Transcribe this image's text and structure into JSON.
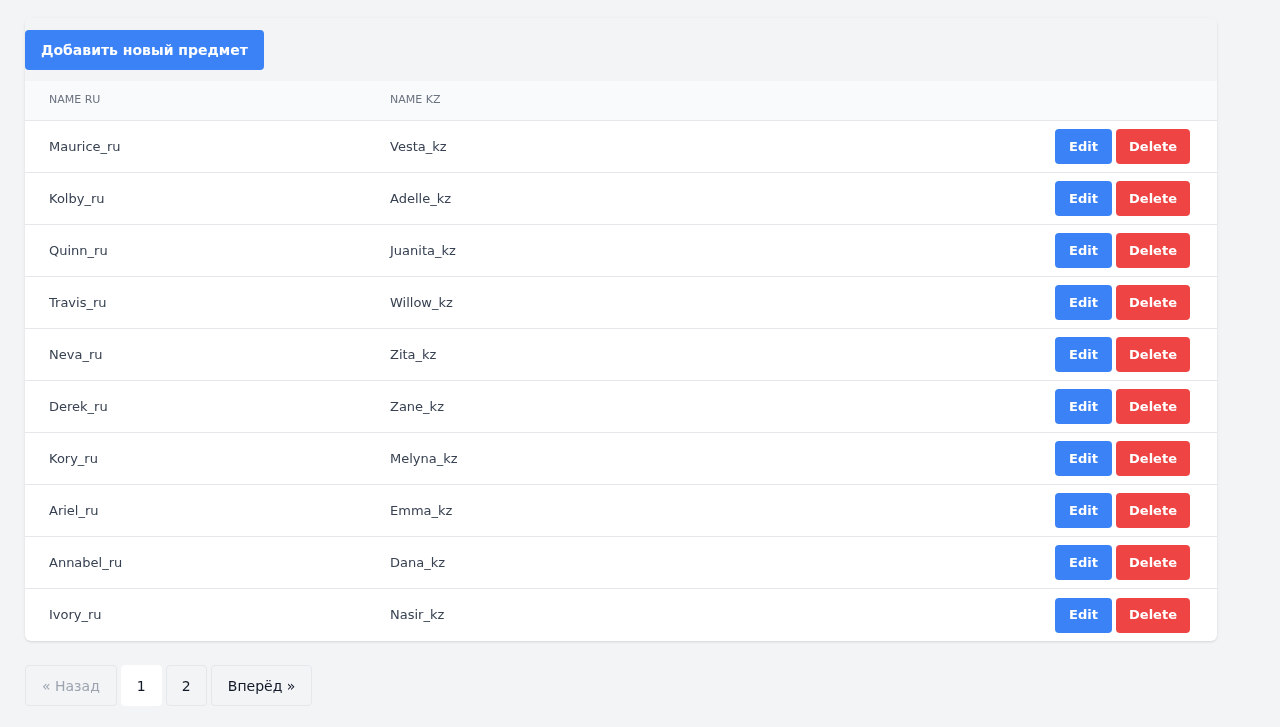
{
  "add_button": "Добавить новый предмет",
  "table": {
    "columns": [
      "NAME RU",
      "NAME KZ"
    ],
    "rows": [
      {
        "name_ru": "Maurice_ru",
        "name_kz": "Vesta_kz",
        "edit": "Edit",
        "delete": "Delete"
      },
      {
        "name_ru": "Kolby_ru",
        "name_kz": "Adelle_kz",
        "edit": "Edit",
        "delete": "Delete"
      },
      {
        "name_ru": "Quinn_ru",
        "name_kz": "Juanita_kz",
        "edit": "Edit",
        "delete": "Delete"
      },
      {
        "name_ru": "Travis_ru",
        "name_kz": "Willow_kz",
        "edit": "Edit",
        "delete": "Delete"
      },
      {
        "name_ru": "Neva_ru",
        "name_kz": "Zita_kz",
        "edit": "Edit",
        "delete": "Delete"
      },
      {
        "name_ru": "Derek_ru",
        "name_kz": "Zane_kz",
        "edit": "Edit",
        "delete": "Delete"
      },
      {
        "name_ru": "Kory_ru",
        "name_kz": "Melyna_kz",
        "edit": "Edit",
        "delete": "Delete"
      },
      {
        "name_ru": "Ariel_ru",
        "name_kz": "Emma_kz",
        "edit": "Edit",
        "delete": "Delete"
      },
      {
        "name_ru": "Annabel_ru",
        "name_kz": "Dana_kz",
        "edit": "Edit",
        "delete": "Delete"
      },
      {
        "name_ru": "Ivory_ru",
        "name_kz": "Nasir_kz",
        "edit": "Edit",
        "delete": "Delete"
      }
    ]
  },
  "pagination": {
    "prev": {
      "label": "« Назад",
      "disabled": true
    },
    "pages": [
      {
        "label": "1",
        "selected": true
      },
      {
        "label": "2",
        "selected": false
      }
    ],
    "next": {
      "label": "Вперёд »",
      "disabled": false
    }
  }
}
